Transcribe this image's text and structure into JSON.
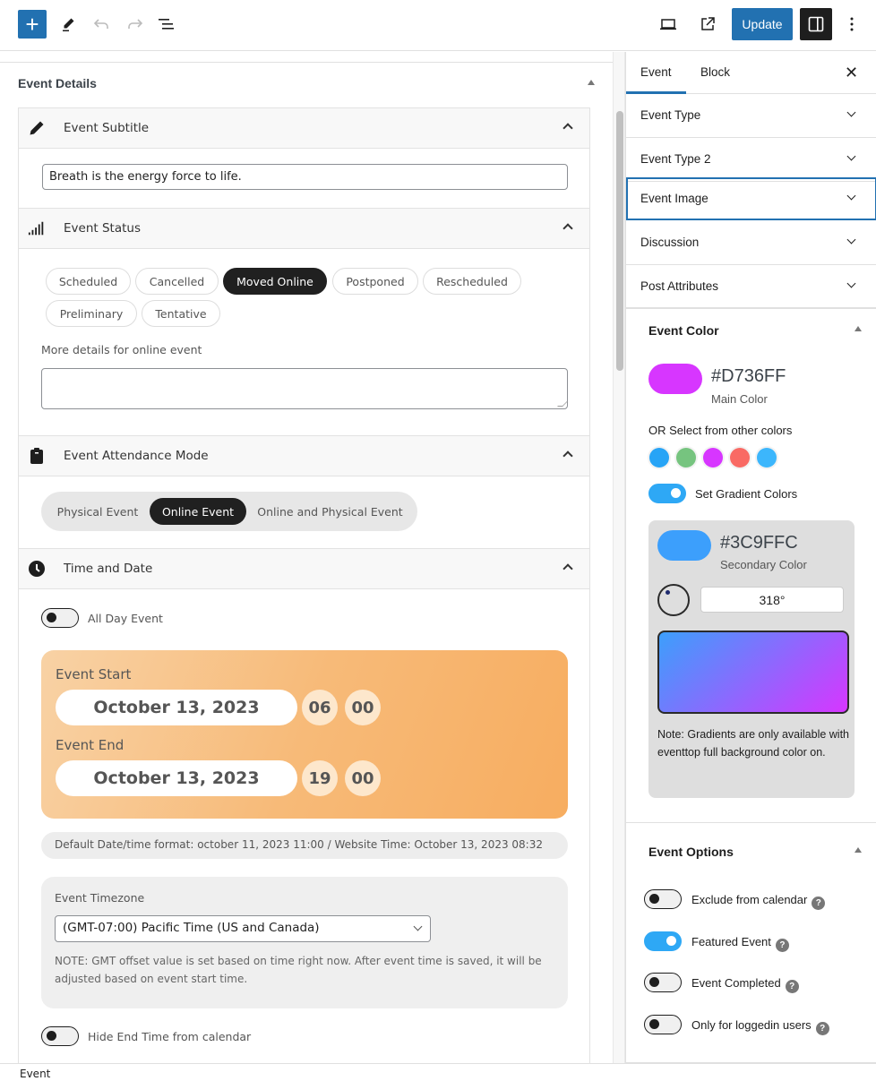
{
  "toolbar": {
    "add_icon": "plus-icon",
    "tools_icon": "pencil-icon",
    "undo_icon": "undo-icon",
    "redo_icon": "redo-icon",
    "list_view_icon": "list-view-icon",
    "preview_icon": "laptop-icon",
    "view_post_icon": "external-link-icon",
    "update_label": "Update",
    "settings_icon": "sidebar-toggle-icon",
    "options_icon": "more-vertical-icon",
    "accent_color": "#2271b1"
  },
  "meta_box": {
    "title": "Event Details",
    "sections": {
      "subtitle": {
        "label": "Event Subtitle",
        "icon": "pencil-icon",
        "value": "Breath is the energy force to life."
      },
      "status": {
        "label": "Event Status",
        "icon": "signal-bars-icon",
        "options": [
          "Scheduled",
          "Cancelled",
          "Moved Online",
          "Postponed",
          "Rescheduled",
          "Preliminary",
          "Tentative"
        ],
        "selected": "Moved Online",
        "details_label": "More details for online event",
        "details_value": ""
      },
      "attendance": {
        "label": "Event Attendance Mode",
        "icon": "clipboard-icon",
        "options": [
          "Physical Event",
          "Online Event",
          "Online and Physical Event"
        ],
        "selected": "Online Event"
      },
      "time_date": {
        "label": "Time and Date",
        "icon": "clock-icon",
        "all_day_label": "All Day Event",
        "all_day": false,
        "start_label": "Event Start",
        "start_date": "October 13, 2023",
        "start_hour": "06",
        "start_minute": "00",
        "end_label": "Event End",
        "end_date": "October 13, 2023",
        "end_hour": "19",
        "end_minute": "00",
        "info": "Default Date/time format: october 11, 2023 11:00 / Website Time: October 13, 2023 08:32",
        "timezone_label": "Event Timezone",
        "timezone_value": "(GMT-07:00) Pacific Time (US and Canada)",
        "timezone_note": "NOTE: GMT offset value is set based on time right now. After event time is saved, it will be adjusted based on event start time.",
        "hide_end_label": "Hide End Time from calendar",
        "hide_end": false
      }
    }
  },
  "sidebar": {
    "tabs": [
      "Event",
      "Block"
    ],
    "active_tab": "Event",
    "close_icon": "close-icon",
    "panels": [
      "Event Type",
      "Event Type 2",
      "Event Image",
      "Discussion",
      "Post Attributes"
    ],
    "focused_panel": "Event Image",
    "event_color": {
      "title": "Event Color",
      "main_hex": "#D736FF",
      "main_label": "Main Color",
      "or_label": "OR Select from other colors",
      "presets": [
        "#27a4f6",
        "#76c47f",
        "#d736ff",
        "#f96a64",
        "#3cb6fc"
      ],
      "gradient_label": "Set Gradient Colors",
      "gradient_on": true,
      "secondary_hex": "#3C9FFC",
      "secondary_label": "Secondary Color",
      "angle": "318°",
      "gradient_note": "Note: Gradients are only available with eventtop full background color on."
    },
    "event_options": {
      "title": "Event Options",
      "items": [
        {
          "label": "Exclude from calendar",
          "on": false
        },
        {
          "label": "Featured Event",
          "on": true
        },
        {
          "label": "Event Completed",
          "on": false
        },
        {
          "label": "Only for loggedin users",
          "on": false
        }
      ],
      "help_glyph": "?"
    }
  },
  "statusbar": {
    "breadcrumb": "Event"
  }
}
